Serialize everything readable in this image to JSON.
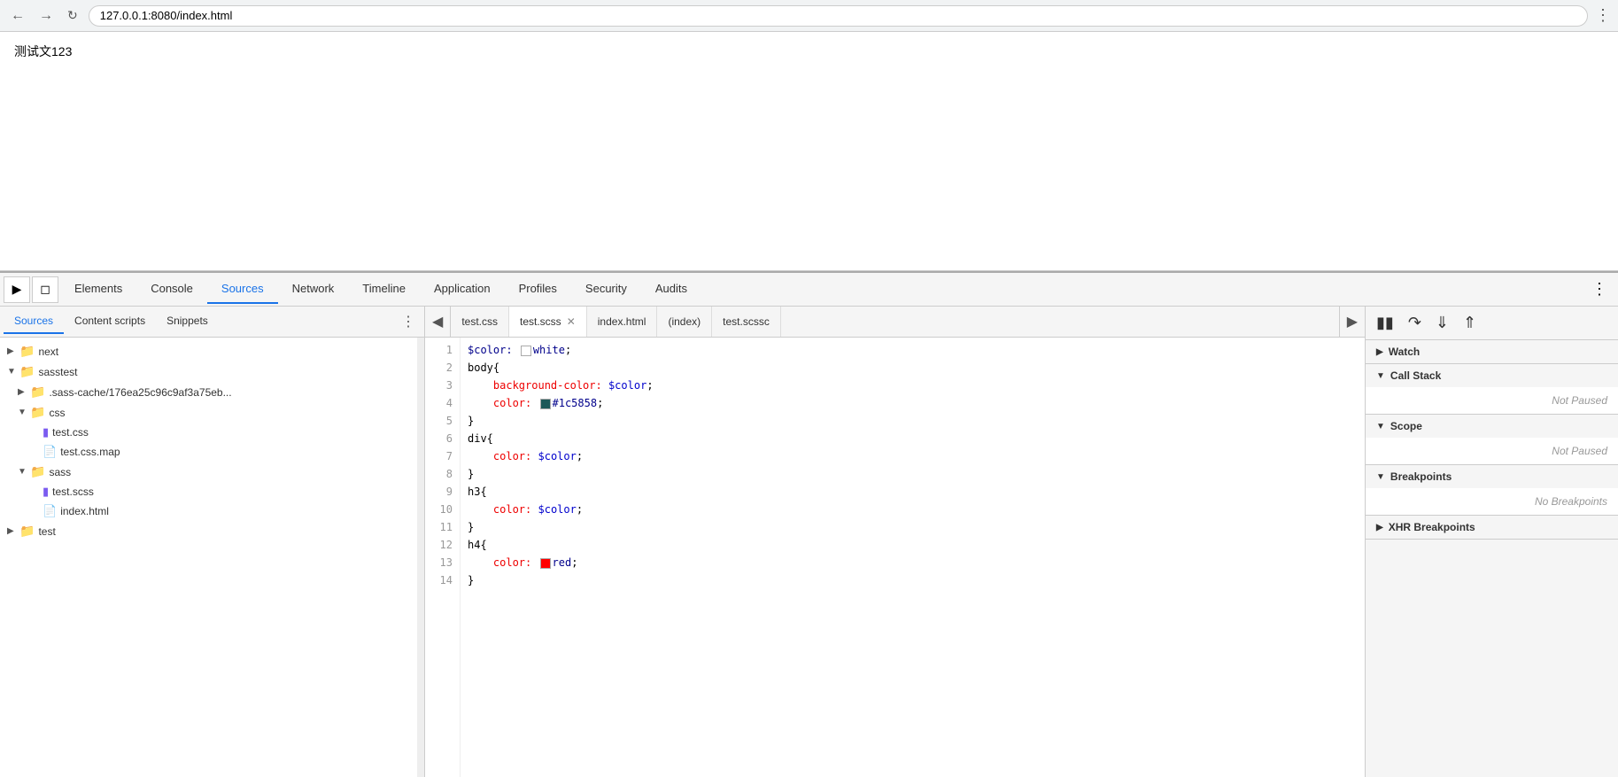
{
  "browser": {
    "url": "127.0.0.1:8080/index.html",
    "page_text": "测试文123"
  },
  "devtools_tabs": {
    "tabs": [
      {
        "label": "Elements",
        "active": false
      },
      {
        "label": "Console",
        "active": false
      },
      {
        "label": "Sources",
        "active": true
      },
      {
        "label": "Network",
        "active": false
      },
      {
        "label": "Timeline",
        "active": false
      },
      {
        "label": "Application",
        "active": false
      },
      {
        "label": "Profiles",
        "active": false
      },
      {
        "label": "Security",
        "active": false
      },
      {
        "label": "Audits",
        "active": false
      }
    ]
  },
  "sources_panel": {
    "tabs": [
      {
        "label": "Sources",
        "active": true
      },
      {
        "label": "Content scripts",
        "active": false
      },
      {
        "label": "Snippets",
        "active": false
      }
    ],
    "file_tree": [
      {
        "id": "next",
        "label": "next",
        "type": "folder",
        "indent": 0,
        "collapsed": true
      },
      {
        "id": "sasstest",
        "label": "sasstest",
        "type": "folder",
        "indent": 0,
        "collapsed": false
      },
      {
        "id": "sass-cache",
        "label": ".sass-cache/176ea25c96c9af3a75eb...",
        "type": "folder",
        "indent": 1,
        "collapsed": true
      },
      {
        "id": "css",
        "label": "css",
        "type": "folder",
        "indent": 1,
        "collapsed": false
      },
      {
        "id": "test.css",
        "label": "test.css",
        "type": "file",
        "fileType": "css",
        "indent": 2
      },
      {
        "id": "test.css.map",
        "label": "test.css.map",
        "type": "file",
        "fileType": "other",
        "indent": 2
      },
      {
        "id": "sass",
        "label": "sass",
        "type": "folder",
        "indent": 1,
        "collapsed": false
      },
      {
        "id": "test.scss",
        "label": "test.scss",
        "type": "file",
        "fileType": "css",
        "indent": 2
      },
      {
        "id": "index.html",
        "label": "index.html",
        "type": "file",
        "fileType": "html",
        "indent": 2
      },
      {
        "id": "test",
        "label": "test",
        "type": "folder",
        "indent": 0,
        "collapsed": true
      }
    ]
  },
  "editor_tabs": [
    {
      "label": "test.css",
      "active": false,
      "closeable": false
    },
    {
      "label": "test.scss",
      "active": true,
      "closeable": true
    },
    {
      "label": "index.html",
      "active": false,
      "closeable": false
    },
    {
      "label": "(index)",
      "active": false,
      "closeable": false
    },
    {
      "label": "test.scssc",
      "active": false,
      "closeable": false
    }
  ],
  "code_lines": [
    {
      "num": 1,
      "tokens": [
        {
          "text": "$color:",
          "class": "kw"
        },
        {
          "text": " ",
          "class": ""
        },
        {
          "swatch": "#ffffff"
        },
        {
          "text": "white",
          "class": "val"
        },
        {
          "text": ";",
          "class": ""
        }
      ]
    },
    {
      "num": 2,
      "tokens": [
        {
          "text": "body{",
          "class": ""
        }
      ]
    },
    {
      "num": 3,
      "tokens": [
        {
          "text": "    background-color:",
          "class": "prop"
        },
        {
          "text": " $color",
          "class": "var"
        },
        {
          "text": ";",
          "class": ""
        }
      ]
    },
    {
      "num": 4,
      "tokens": [
        {
          "text": "    color:",
          "class": "prop"
        },
        {
          "text": " ",
          "class": ""
        },
        {
          "swatch": "#1c5858"
        },
        {
          "text": "#1c5858",
          "class": "val"
        },
        {
          "text": ";",
          "class": ""
        }
      ]
    },
    {
      "num": 5,
      "tokens": [
        {
          "text": "}",
          "class": ""
        }
      ]
    },
    {
      "num": 6,
      "tokens": [
        {
          "text": "div{",
          "class": ""
        }
      ]
    },
    {
      "num": 7,
      "tokens": [
        {
          "text": "    color:",
          "class": "prop"
        },
        {
          "text": " $color",
          "class": "var"
        },
        {
          "text": ";",
          "class": ""
        }
      ]
    },
    {
      "num": 8,
      "tokens": [
        {
          "text": "}",
          "class": ""
        }
      ]
    },
    {
      "num": 9,
      "tokens": [
        {
          "text": "h3{",
          "class": ""
        }
      ]
    },
    {
      "num": 10,
      "tokens": [
        {
          "text": "    color:",
          "class": "prop"
        },
        {
          "text": " $color",
          "class": "var"
        },
        {
          "text": ";",
          "class": ""
        }
      ]
    },
    {
      "num": 11,
      "tokens": [
        {
          "text": "}",
          "class": ""
        }
      ]
    },
    {
      "num": 12,
      "tokens": [
        {
          "text": "h4{",
          "class": ""
        }
      ]
    },
    {
      "num": 13,
      "tokens": [
        {
          "text": "    color:",
          "class": "prop"
        },
        {
          "text": " ",
          "class": ""
        },
        {
          "swatch": "#ff0000"
        },
        {
          "text": "red",
          "class": "val"
        },
        {
          "text": ";",
          "class": ""
        }
      ]
    },
    {
      "num": 14,
      "tokens": [
        {
          "text": "}",
          "class": ""
        }
      ]
    }
  ],
  "right_panel": {
    "debug_buttons": [
      "pause",
      "step-over",
      "step-into",
      "step-out"
    ],
    "sections": [
      {
        "label": "Watch",
        "expanded": false,
        "content": null
      },
      {
        "label": "Call Stack",
        "expanded": true,
        "content": "Not Paused"
      },
      {
        "label": "Scope",
        "expanded": true,
        "content": "Not Paused"
      },
      {
        "label": "Breakpoints",
        "expanded": true,
        "content": "No Breakpoints"
      },
      {
        "label": "XHR Breakpoints",
        "expanded": false,
        "content": null
      }
    ]
  }
}
